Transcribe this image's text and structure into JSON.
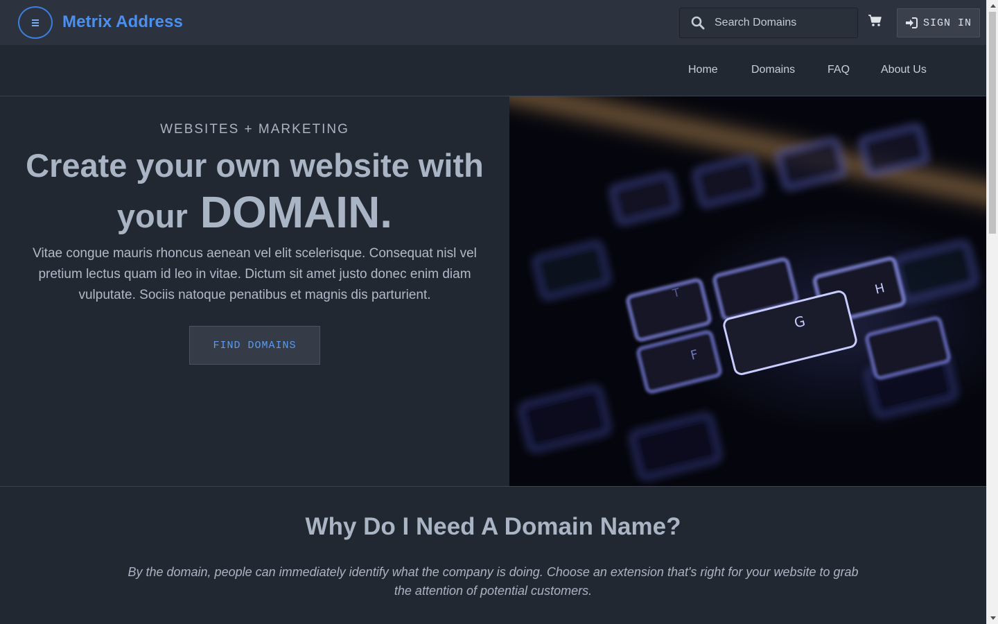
{
  "header": {
    "brand": "Metrix Address",
    "search_placeholder": "Search Domains",
    "signin_label": "SIGN IN"
  },
  "nav": {
    "items": [
      "Home",
      "Domains",
      "FAQ",
      "About Us"
    ]
  },
  "hero": {
    "eyebrow": "WEBSITES + MARKETING",
    "headline_line1": "Create your own website with",
    "headline_line2_prefix": "your",
    "headline_line2_emphasis": "DOMAIN.",
    "lead": "Vitae congue mauris rhoncus aenean vel elit scelerisque. Consequat nisl vel pretium lectus quam id leo in vitae. Dictum sit amet justo donec enim diam vulputate. Sociis natoque penatibus et magnis dis parturient.",
    "cta_label": "FIND DOMAINS"
  },
  "why": {
    "title": "Why Do I Need A Domain Name?",
    "text": "By the domain, people can immediately identify what the company is doing. Choose an extension that's right for your website to grab the attention of potential customers."
  },
  "colors": {
    "background": "#222831",
    "topbar": "#2c333e",
    "accent": "#4b8fef",
    "heading": "#a9b4c4"
  },
  "icons": {
    "menu": "menu-icon",
    "search": "search-icon",
    "cart": "cart-icon",
    "signin": "sign-in-icon"
  }
}
